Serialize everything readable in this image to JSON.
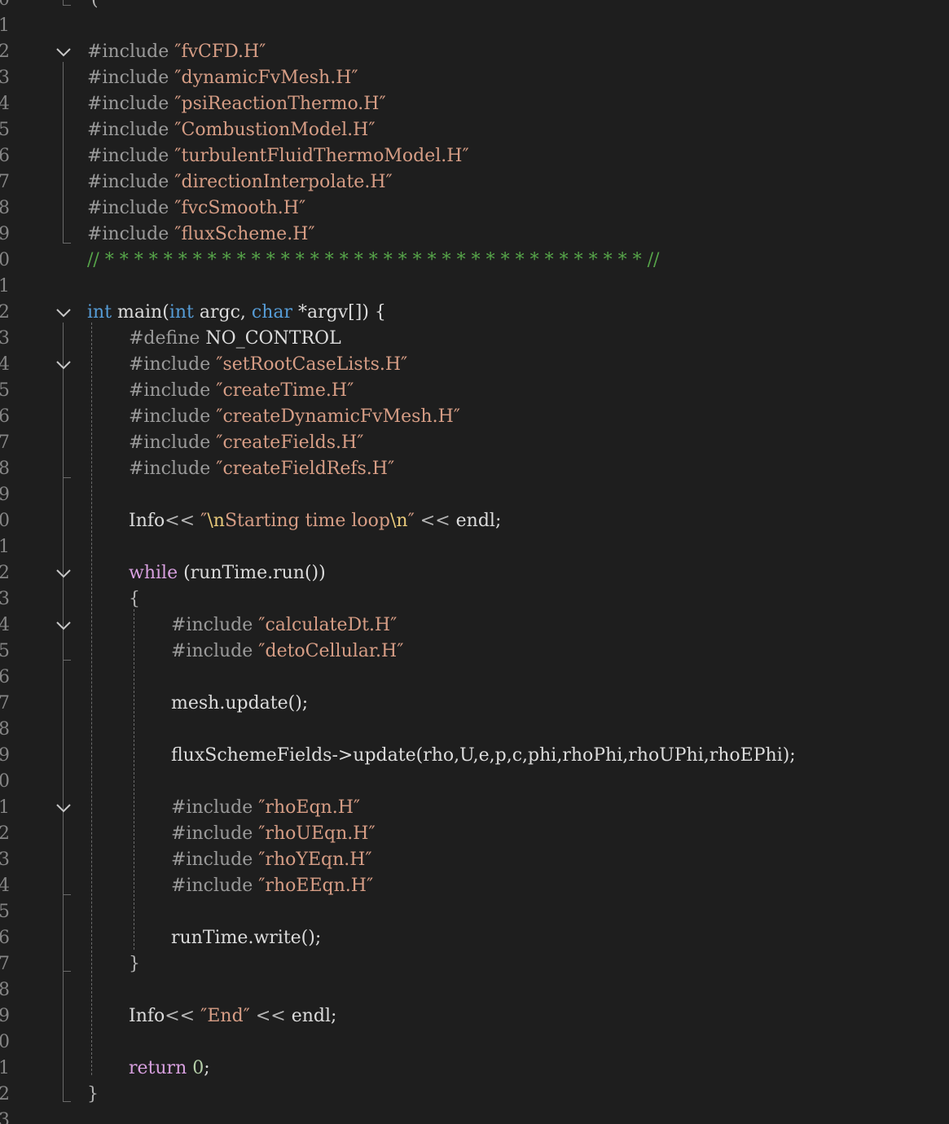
{
  "editor": {
    "language": "cpp",
    "lines": [
      {
        "n": "0",
        "fold": false,
        "indent": 0,
        "tokens": [
          {
            "t": "(",
            "c": "op"
          }
        ]
      },
      {
        "n": "1",
        "fold": false,
        "indent": 0,
        "tokens": []
      },
      {
        "n": "2",
        "fold": true,
        "indent": 0,
        "tokens": [
          {
            "t": "#include ",
            "c": "pp"
          },
          {
            "t": "″fvCFD.H″",
            "c": "str"
          }
        ]
      },
      {
        "n": "3",
        "fold": false,
        "indent": 0,
        "tokens": [
          {
            "t": "#include ",
            "c": "pp"
          },
          {
            "t": "″dynamicFvMesh.H″",
            "c": "str"
          }
        ]
      },
      {
        "n": "4",
        "fold": false,
        "indent": 0,
        "tokens": [
          {
            "t": "#include ",
            "c": "pp"
          },
          {
            "t": "″psiReactionThermo.H″",
            "c": "str"
          }
        ]
      },
      {
        "n": "5",
        "fold": false,
        "indent": 0,
        "tokens": [
          {
            "t": "#include ",
            "c": "pp"
          },
          {
            "t": "″CombustionModel.H″",
            "c": "str"
          }
        ]
      },
      {
        "n": "6",
        "fold": false,
        "indent": 0,
        "tokens": [
          {
            "t": "#include ",
            "c": "pp"
          },
          {
            "t": "″turbulentFluidThermoModel.H″",
            "c": "str"
          }
        ]
      },
      {
        "n": "7",
        "fold": false,
        "indent": 0,
        "tokens": [
          {
            "t": "#include ",
            "c": "pp"
          },
          {
            "t": "″directionInterpolate.H″",
            "c": "str"
          }
        ]
      },
      {
        "n": "8",
        "fold": false,
        "indent": 0,
        "tokens": [
          {
            "t": "#include ",
            "c": "pp"
          },
          {
            "t": "″fvcSmooth.H″",
            "c": "str"
          }
        ]
      },
      {
        "n": "9",
        "fold": false,
        "indent": 0,
        "tokens": [
          {
            "t": "#include ",
            "c": "pp"
          },
          {
            "t": "″fluxScheme.H″",
            "c": "str"
          }
        ]
      },
      {
        "n": "0",
        "fold": false,
        "indent": 0,
        "tokens": [
          {
            "t": "// * * * * * * * * * * * * * * * * * * * * * * * * * * * * * * * * * * * * * //",
            "c": "com"
          }
        ]
      },
      {
        "n": "1",
        "fold": false,
        "indent": 0,
        "tokens": []
      },
      {
        "n": "2",
        "fold": true,
        "indent": 0,
        "tokens": [
          {
            "t": "int",
            "c": "kw"
          },
          {
            "t": " main(",
            "c": "txt"
          },
          {
            "t": "int",
            "c": "kw"
          },
          {
            "t": " argc, ",
            "c": "txt"
          },
          {
            "t": "char",
            "c": "kw"
          },
          {
            "t": " *argv[]) {",
            "c": "txt"
          }
        ]
      },
      {
        "n": "3",
        "fold": false,
        "indent": 1,
        "tokens": [
          {
            "t": "#define ",
            "c": "pp"
          },
          {
            "t": "NO_CONTROL",
            "c": "mac"
          }
        ]
      },
      {
        "n": "4",
        "fold": true,
        "indent": 1,
        "tokens": [
          {
            "t": "#include ",
            "c": "pp"
          },
          {
            "t": "″setRootCaseLists.H″",
            "c": "str"
          }
        ]
      },
      {
        "n": "5",
        "fold": false,
        "indent": 1,
        "tokens": [
          {
            "t": "#include ",
            "c": "pp"
          },
          {
            "t": "″createTime.H″",
            "c": "str"
          }
        ]
      },
      {
        "n": "6",
        "fold": false,
        "indent": 1,
        "tokens": [
          {
            "t": "#include ",
            "c": "pp"
          },
          {
            "t": "″createDynamicFvMesh.H″",
            "c": "str"
          }
        ]
      },
      {
        "n": "7",
        "fold": false,
        "indent": 1,
        "tokens": [
          {
            "t": "#include ",
            "c": "pp"
          },
          {
            "t": "″createFields.H″",
            "c": "str"
          }
        ]
      },
      {
        "n": "8",
        "fold": false,
        "indent": 1,
        "tokens": [
          {
            "t": "#include ",
            "c": "pp"
          },
          {
            "t": "″createFieldRefs.H″",
            "c": "str"
          }
        ]
      },
      {
        "n": "9",
        "fold": false,
        "indent": 1,
        "tokens": []
      },
      {
        "n": "0",
        "fold": false,
        "indent": 1,
        "tokens": [
          {
            "t": "Info",
            "c": "txt"
          },
          {
            "t": "<< ",
            "c": "op"
          },
          {
            "t": "″",
            "c": "str"
          },
          {
            "t": "\\n",
            "c": "esc"
          },
          {
            "t": "Starting time loop",
            "c": "str"
          },
          {
            "t": "\\n",
            "c": "esc"
          },
          {
            "t": "″",
            "c": "str"
          },
          {
            "t": " << ",
            "c": "op"
          },
          {
            "t": "endl;",
            "c": "txt"
          }
        ]
      },
      {
        "n": "1",
        "fold": false,
        "indent": 1,
        "tokens": []
      },
      {
        "n": "2",
        "fold": true,
        "indent": 1,
        "tokens": [
          {
            "t": "while",
            "c": "ctl"
          },
          {
            "t": " (runTime.run())",
            "c": "txt"
          }
        ]
      },
      {
        "n": "3",
        "fold": false,
        "indent": 1,
        "tokens": [
          {
            "t": "{",
            "c": "op"
          }
        ]
      },
      {
        "n": "4",
        "fold": true,
        "indent": 2,
        "tokens": [
          {
            "t": "#include ",
            "c": "pp"
          },
          {
            "t": "″calculateDt.H″",
            "c": "str"
          }
        ]
      },
      {
        "n": "5",
        "fold": false,
        "indent": 2,
        "tokens": [
          {
            "t": "#include ",
            "c": "pp"
          },
          {
            "t": "″detoCellular.H″",
            "c": "str"
          }
        ]
      },
      {
        "n": "6",
        "fold": false,
        "indent": 2,
        "tokens": []
      },
      {
        "n": "7",
        "fold": false,
        "indent": 2,
        "tokens": [
          {
            "t": "mesh.update();",
            "c": "txt"
          }
        ]
      },
      {
        "n": "8",
        "fold": false,
        "indent": 2,
        "tokens": []
      },
      {
        "n": "9",
        "fold": false,
        "indent": 2,
        "tokens": [
          {
            "t": "fluxSchemeFields->update(rho,U,e,p,c,phi,rhoPhi,rhoUPhi,rhoEPhi);",
            "c": "txt"
          }
        ]
      },
      {
        "n": "0",
        "fold": false,
        "indent": 2,
        "tokens": []
      },
      {
        "n": "1",
        "fold": true,
        "indent": 2,
        "tokens": [
          {
            "t": "#include ",
            "c": "pp"
          },
          {
            "t": "″rhoEqn.H″",
            "c": "str"
          }
        ]
      },
      {
        "n": "2",
        "fold": false,
        "indent": 2,
        "tokens": [
          {
            "t": "#include ",
            "c": "pp"
          },
          {
            "t": "″rhoUEqn.H″",
            "c": "str"
          }
        ]
      },
      {
        "n": "3",
        "fold": false,
        "indent": 2,
        "tokens": [
          {
            "t": "#include ",
            "c": "pp"
          },
          {
            "t": "″rhoYEqn.H″",
            "c": "str"
          }
        ]
      },
      {
        "n": "4",
        "fold": false,
        "indent": 2,
        "tokens": [
          {
            "t": "#include ",
            "c": "pp"
          },
          {
            "t": "″rhoEEqn.H″",
            "c": "str"
          }
        ]
      },
      {
        "n": "5",
        "fold": false,
        "indent": 2,
        "tokens": []
      },
      {
        "n": "6",
        "fold": false,
        "indent": 2,
        "tokens": [
          {
            "t": "runTime.write();",
            "c": "txt"
          }
        ]
      },
      {
        "n": "7",
        "fold": false,
        "indent": 1,
        "tokens": [
          {
            "t": "}",
            "c": "op"
          }
        ]
      },
      {
        "n": "8",
        "fold": false,
        "indent": 1,
        "tokens": []
      },
      {
        "n": "9",
        "fold": false,
        "indent": 1,
        "tokens": [
          {
            "t": "Info",
            "c": "txt"
          },
          {
            "t": "<< ",
            "c": "op"
          },
          {
            "t": "″End″",
            "c": "str"
          },
          {
            "t": " << ",
            "c": "op"
          },
          {
            "t": "endl;",
            "c": "txt"
          }
        ]
      },
      {
        "n": "0",
        "fold": false,
        "indent": 1,
        "tokens": []
      },
      {
        "n": "1",
        "fold": false,
        "indent": 1,
        "tokens": [
          {
            "t": "return",
            "c": "ctl"
          },
          {
            "t": " ",
            "c": "txt"
          },
          {
            "t": "0",
            "c": "num"
          },
          {
            "t": ";",
            "c": "txt"
          }
        ]
      },
      {
        "n": "2",
        "fold": false,
        "indent": 0,
        "tokens": [
          {
            "t": "}",
            "c": "op"
          }
        ]
      },
      {
        "n": "3",
        "fold": false,
        "indent": 0,
        "tokens": []
      }
    ]
  }
}
